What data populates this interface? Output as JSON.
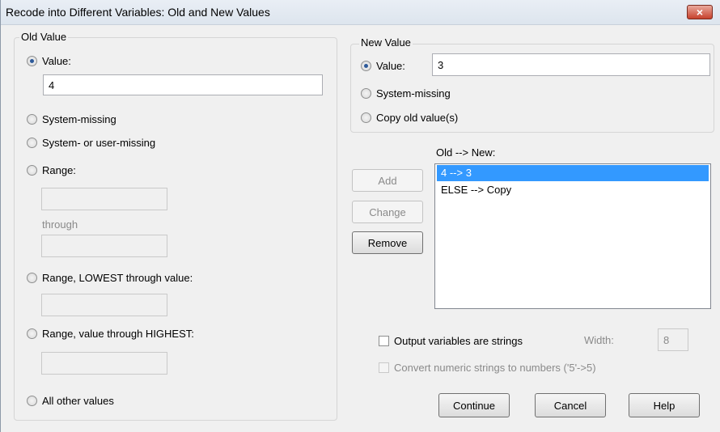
{
  "window": {
    "title": "Recode into Different Variables: Old and New Values",
    "close_icon": "×"
  },
  "old_value": {
    "group_label": "Old Value",
    "value_label": "Value:",
    "value_input": "4",
    "system_missing_label": "System-missing",
    "system_or_user_missing_label": "System- or user-missing",
    "range_label": "Range:",
    "range_from": "",
    "through_label": "through",
    "range_to": "",
    "range_lowest_label": "Range, LOWEST through value:",
    "range_lowest_input": "",
    "range_highest_label": "Range, value through HIGHEST:",
    "range_highest_input": "",
    "all_other_label": "All other values"
  },
  "new_value": {
    "group_label": "New Value",
    "value_label": "Value:",
    "value_input": "3",
    "system_missing_label": "System-missing",
    "copy_old_label": "Copy old value(s)"
  },
  "mapping": {
    "list_label": "Old --> New:",
    "items": [
      "4 --> 3",
      "ELSE --> Copy"
    ],
    "add_label": "Add",
    "change_label": "Change",
    "remove_label": "Remove"
  },
  "options": {
    "output_strings_label": "Output variables are strings",
    "width_label": "Width:",
    "width_value": "8",
    "convert_label": "Convert numeric strings to numbers ('5'->5)"
  },
  "footer": {
    "continue_label": "Continue",
    "cancel_label": "Cancel",
    "help_label": "Help"
  }
}
